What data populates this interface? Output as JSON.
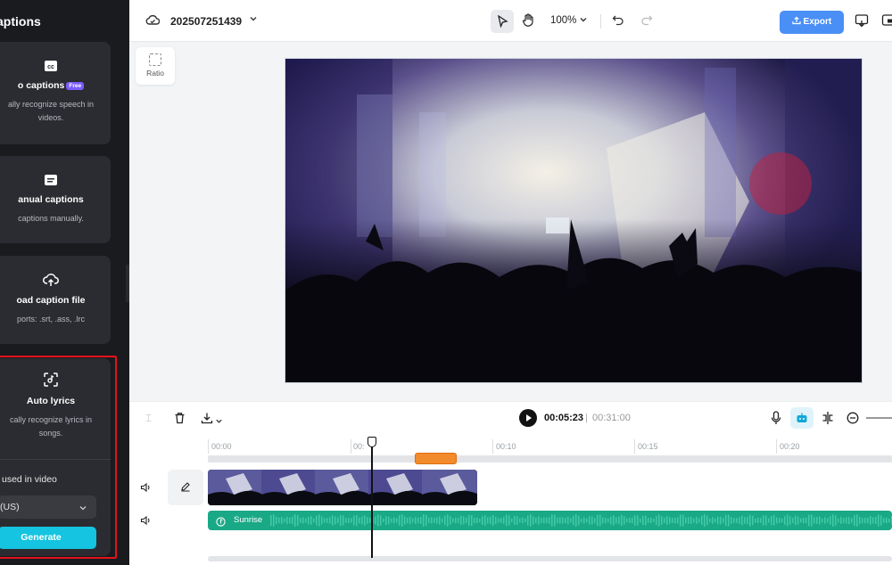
{
  "sidebar": {
    "title": "aptions",
    "cards": [
      {
        "icon": "cc-icon",
        "title": "o captions",
        "badge": "Free",
        "desc_lines": [
          "ally recognize speech in",
          "videos."
        ]
      },
      {
        "icon": "subtitle-icon",
        "title": "anual captions",
        "desc_lines": [
          "captions manually."
        ]
      },
      {
        "icon": "cloud-upload-icon",
        "title": "oad caption file",
        "desc_lines": [
          "ports: .srt, .ass, .lrc"
        ]
      },
      {
        "icon": "face-scan-icon",
        "title": "Auto lyrics",
        "desc_lines": [
          "cally recognize lyrics in",
          "songs."
        ]
      }
    ],
    "language_label": "used in video",
    "language_value": "(US)",
    "generate_label": "Generate"
  },
  "topbar": {
    "project_name": "202507251439",
    "zoom": "100%",
    "export_label": "Export"
  },
  "canvas": {
    "ratio_label": "Ratio"
  },
  "player": {
    "current_time": "00:05:23",
    "separator": "|",
    "total_time": "00:31:00"
  },
  "timeline": {
    "ticks": [
      "00:00",
      "00:",
      "00:10",
      "00:15",
      "00:20"
    ],
    "audio_label": "Sunrise"
  },
  "colors": {
    "accent": "#4a8ff6",
    "generate": "#14c4e0",
    "highlight": "#e4121b",
    "audio_track": "#1aa987"
  }
}
